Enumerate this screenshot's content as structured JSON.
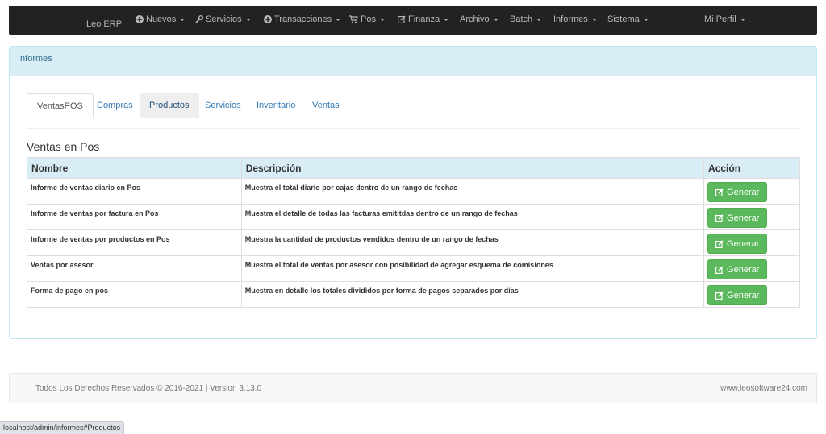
{
  "navbar": {
    "brand": "Leo ERP",
    "items": [
      {
        "label": "Nuevos",
        "icon": "plus-circle-icon"
      },
      {
        "label": "Servicios",
        "icon": "wrench-icon"
      },
      {
        "label": "Transacciones",
        "icon": "plus-circle-icon"
      },
      {
        "label": "Pos",
        "icon": "cart-icon"
      },
      {
        "label": "Finanza",
        "icon": "edit-icon"
      },
      {
        "label": "Archivo",
        "icon": ""
      },
      {
        "label": "Batch",
        "icon": ""
      },
      {
        "label": "Informes",
        "icon": ""
      },
      {
        "label": "Sistema",
        "icon": ""
      },
      {
        "label": "Mi Perfil",
        "icon": ""
      }
    ]
  },
  "panel": {
    "heading": "Informes",
    "tabs": [
      "VentasPOS",
      "Compras",
      "Productos",
      "Servicios",
      "Inventario",
      "Ventas"
    ],
    "active_tab": "VentasPOS",
    "hover_tab": "Productos",
    "section_title": "Ventas en Pos",
    "table": {
      "headers": [
        "Nombre",
        "Descripción",
        "Acción"
      ],
      "rows": [
        {
          "nombre": "Informe de ventas diario en Pos",
          "descripcion": "Muestra el total diario por cajas dentro de un rango de fechas",
          "accion": "Generar"
        },
        {
          "nombre": "Informe de ventas por factura en Pos",
          "descripcion": "Muestra el detalle de todas las facturas emititdas dentro de un rango de fechas",
          "accion": "Generar"
        },
        {
          "nombre": "Informe de ventas por productos en Pos",
          "descripcion": "Muestra la cantidad de productos vendidos dentro de un rango de fechas",
          "accion": "Generar"
        },
        {
          "nombre": "Ventas por asesor",
          "descripcion": "Muestra el total de ventas por asesor con posibilidad de agregar esquema de comisiones",
          "accion": "Generar"
        },
        {
          "nombre": "Forma de pago en pos",
          "descripcion": "Muestra en detalle los totales divididos por forma de pagos separados por días",
          "accion": "Generar"
        }
      ]
    }
  },
  "footer": {
    "copyright": "Todos Los Derechos Reservados © 2016-2021 | Version 3.13.0",
    "site": "www.leosoftware24.com"
  },
  "status_url": "localhost/admin/informes#Productos",
  "colors": {
    "navbar_bg": "#222222",
    "panel_heading_bg": "#d9edf7",
    "button_green": "#5cb85c",
    "link_blue": "#337ab7"
  }
}
